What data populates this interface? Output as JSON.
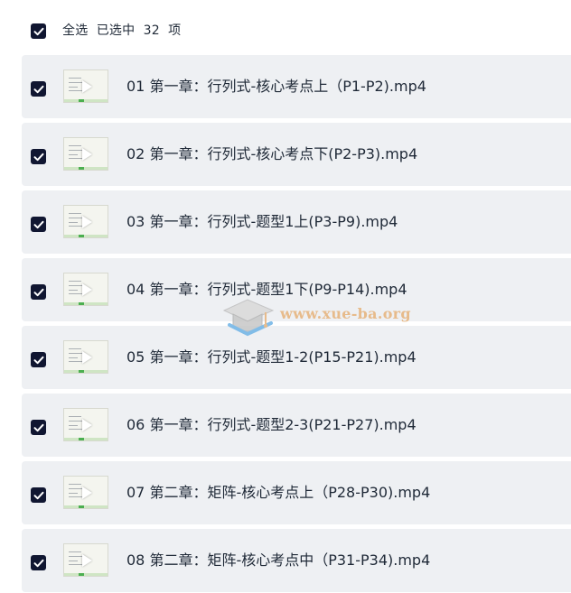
{
  "header": {
    "select_all_label": "全选",
    "selected_text": "已选中",
    "selected_count": "32",
    "item_unit": "项"
  },
  "files": [
    {
      "title": "01 第一章：行列式-核心考点上（P1-P2).mp4",
      "checked": true
    },
    {
      "title": "02 第一章：行列式-核心考点下(P2-P3).mp4",
      "checked": true
    },
    {
      "title": "03 第一章：行列式-题型1上(P3-P9).mp4",
      "checked": true
    },
    {
      "title": "04 第一章：行列式-题型1下(P9-P14).mp4",
      "checked": true
    },
    {
      "title": "05 第一章：行列式-题型1-2(P15-P21).mp4",
      "checked": true
    },
    {
      "title": "06 第一章：行列式-题型2-3(P21-P27).mp4",
      "checked": true
    },
    {
      "title": "07 第二章：矩阵-核心考点上（P28-P30).mp4",
      "checked": true
    },
    {
      "title": "08 第二章：矩阵-核心考点中（P31-P34).mp4",
      "checked": true
    }
  ],
  "watermark": {
    "text": "www.xue-ba.org"
  },
  "colors": {
    "checkbox_fill": "#101631",
    "row_background": "#eef0f3",
    "watermark": "#e6b27a"
  },
  "icons": {
    "checkbox": "checkmark-icon",
    "thumbnail": "video-thumbnail",
    "play": "play-icon",
    "watermark_logo": "graduation-cap-icon"
  }
}
